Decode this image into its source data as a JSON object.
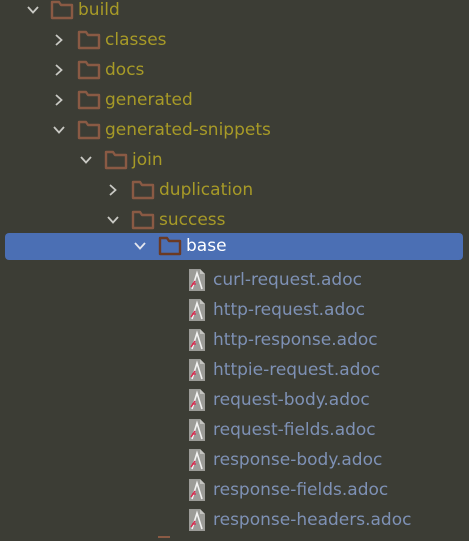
{
  "tree": {
    "build": {
      "label": "build"
    },
    "classes": {
      "label": "classes"
    },
    "docs": {
      "label": "docs"
    },
    "generated": {
      "label": "generated"
    },
    "generated_snippets": {
      "label": "generated-snippets"
    },
    "join": {
      "label": "join"
    },
    "duplication": {
      "label": "duplication"
    },
    "success": {
      "label": "success"
    },
    "base": {
      "label": "base"
    },
    "files": [
      {
        "label": "curl-request.adoc"
      },
      {
        "label": "http-request.adoc"
      },
      {
        "label": "http-response.adoc"
      },
      {
        "label": "httpie-request.adoc"
      },
      {
        "label": "request-body.adoc"
      },
      {
        "label": "request-fields.adoc"
      },
      {
        "label": "response-body.adoc"
      },
      {
        "label": "response-fields.adoc"
      },
      {
        "label": "response-headers.adoc"
      }
    ]
  },
  "colors": {
    "background": "#3c3d35",
    "selection": "#4b6fb4",
    "folder_label": "#a79a27",
    "file_label": "#7e91b5",
    "folder_icon": "#8a5a44"
  },
  "icons": {
    "expanded": "chevron-down-icon",
    "collapsed": "chevron-right-icon",
    "folder": "folder-icon",
    "asciidoc": "asciidoc-file-icon"
  }
}
